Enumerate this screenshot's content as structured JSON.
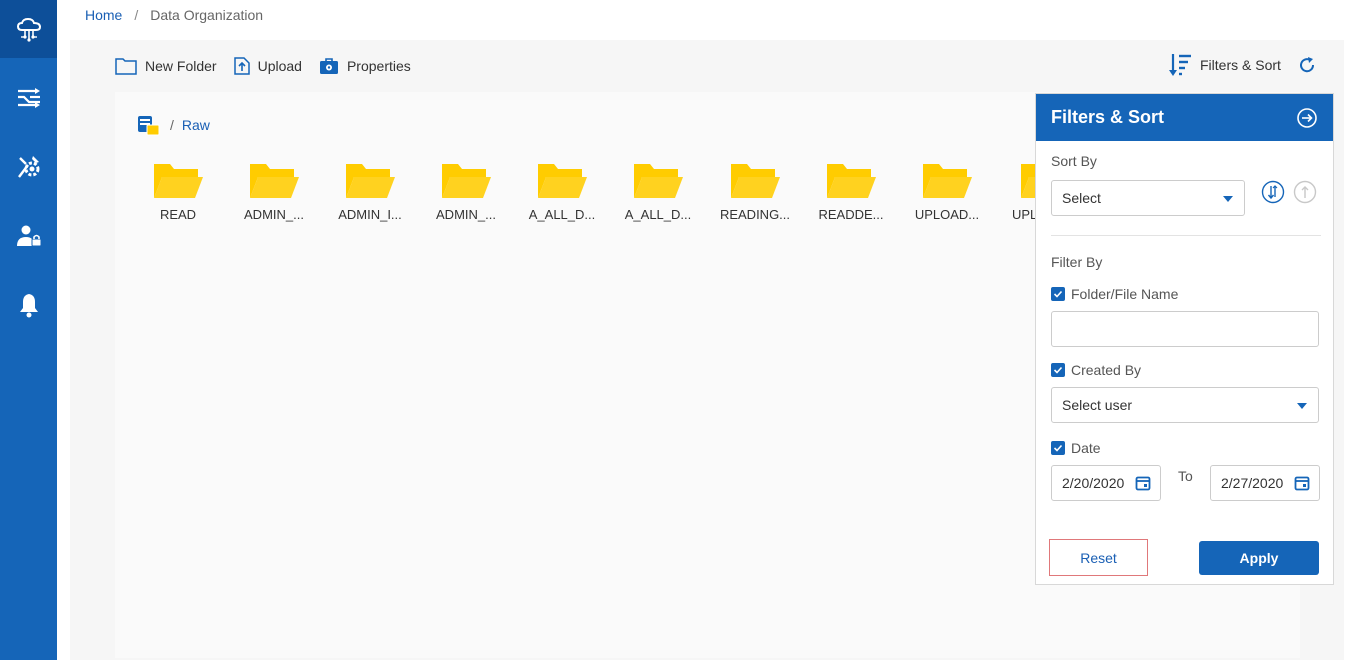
{
  "breadcrumb": {
    "home": "Home",
    "separator": "/",
    "current": "Data Organization"
  },
  "sidebar": {
    "items": [
      {
        "icon": "cloud-network-icon",
        "active": true
      },
      {
        "icon": "pipeline-icon",
        "active": false
      },
      {
        "icon": "tools-gear-icon",
        "active": false
      },
      {
        "icon": "user-lock-icon",
        "active": false
      },
      {
        "icon": "bell-icon",
        "active": false
      }
    ]
  },
  "toolbar": {
    "new_folder": "New Folder",
    "upload": "Upload",
    "properties": "Properties",
    "filters_sort": "Filters & Sort"
  },
  "path": {
    "separator": "/",
    "current": "Raw"
  },
  "folders": [
    "READ",
    "ADMIN_...",
    "ADMIN_I...",
    "ADMIN_...",
    "A_ALL_D...",
    "A_ALL_D...",
    "READING...",
    "READDE...",
    "UPLOAD...",
    "UPL"
  ],
  "filters_panel": {
    "title": "Filters & Sort",
    "sort_by_label": "Sort By",
    "sort_select": "Select",
    "filter_by_label": "Filter By",
    "name_filter_label": "Folder/File Name",
    "name_filter_value": "",
    "created_by_label": "Created By",
    "created_by_select": "Select user",
    "date_label": "Date",
    "date_from": "2/20/2020",
    "to_label": "To",
    "date_to": "2/27/2020",
    "reset": "Reset",
    "apply": "Apply"
  },
  "colors": {
    "primary": "#1565b8",
    "folder": "#ffcc00",
    "reset_border": "#e0787a"
  }
}
